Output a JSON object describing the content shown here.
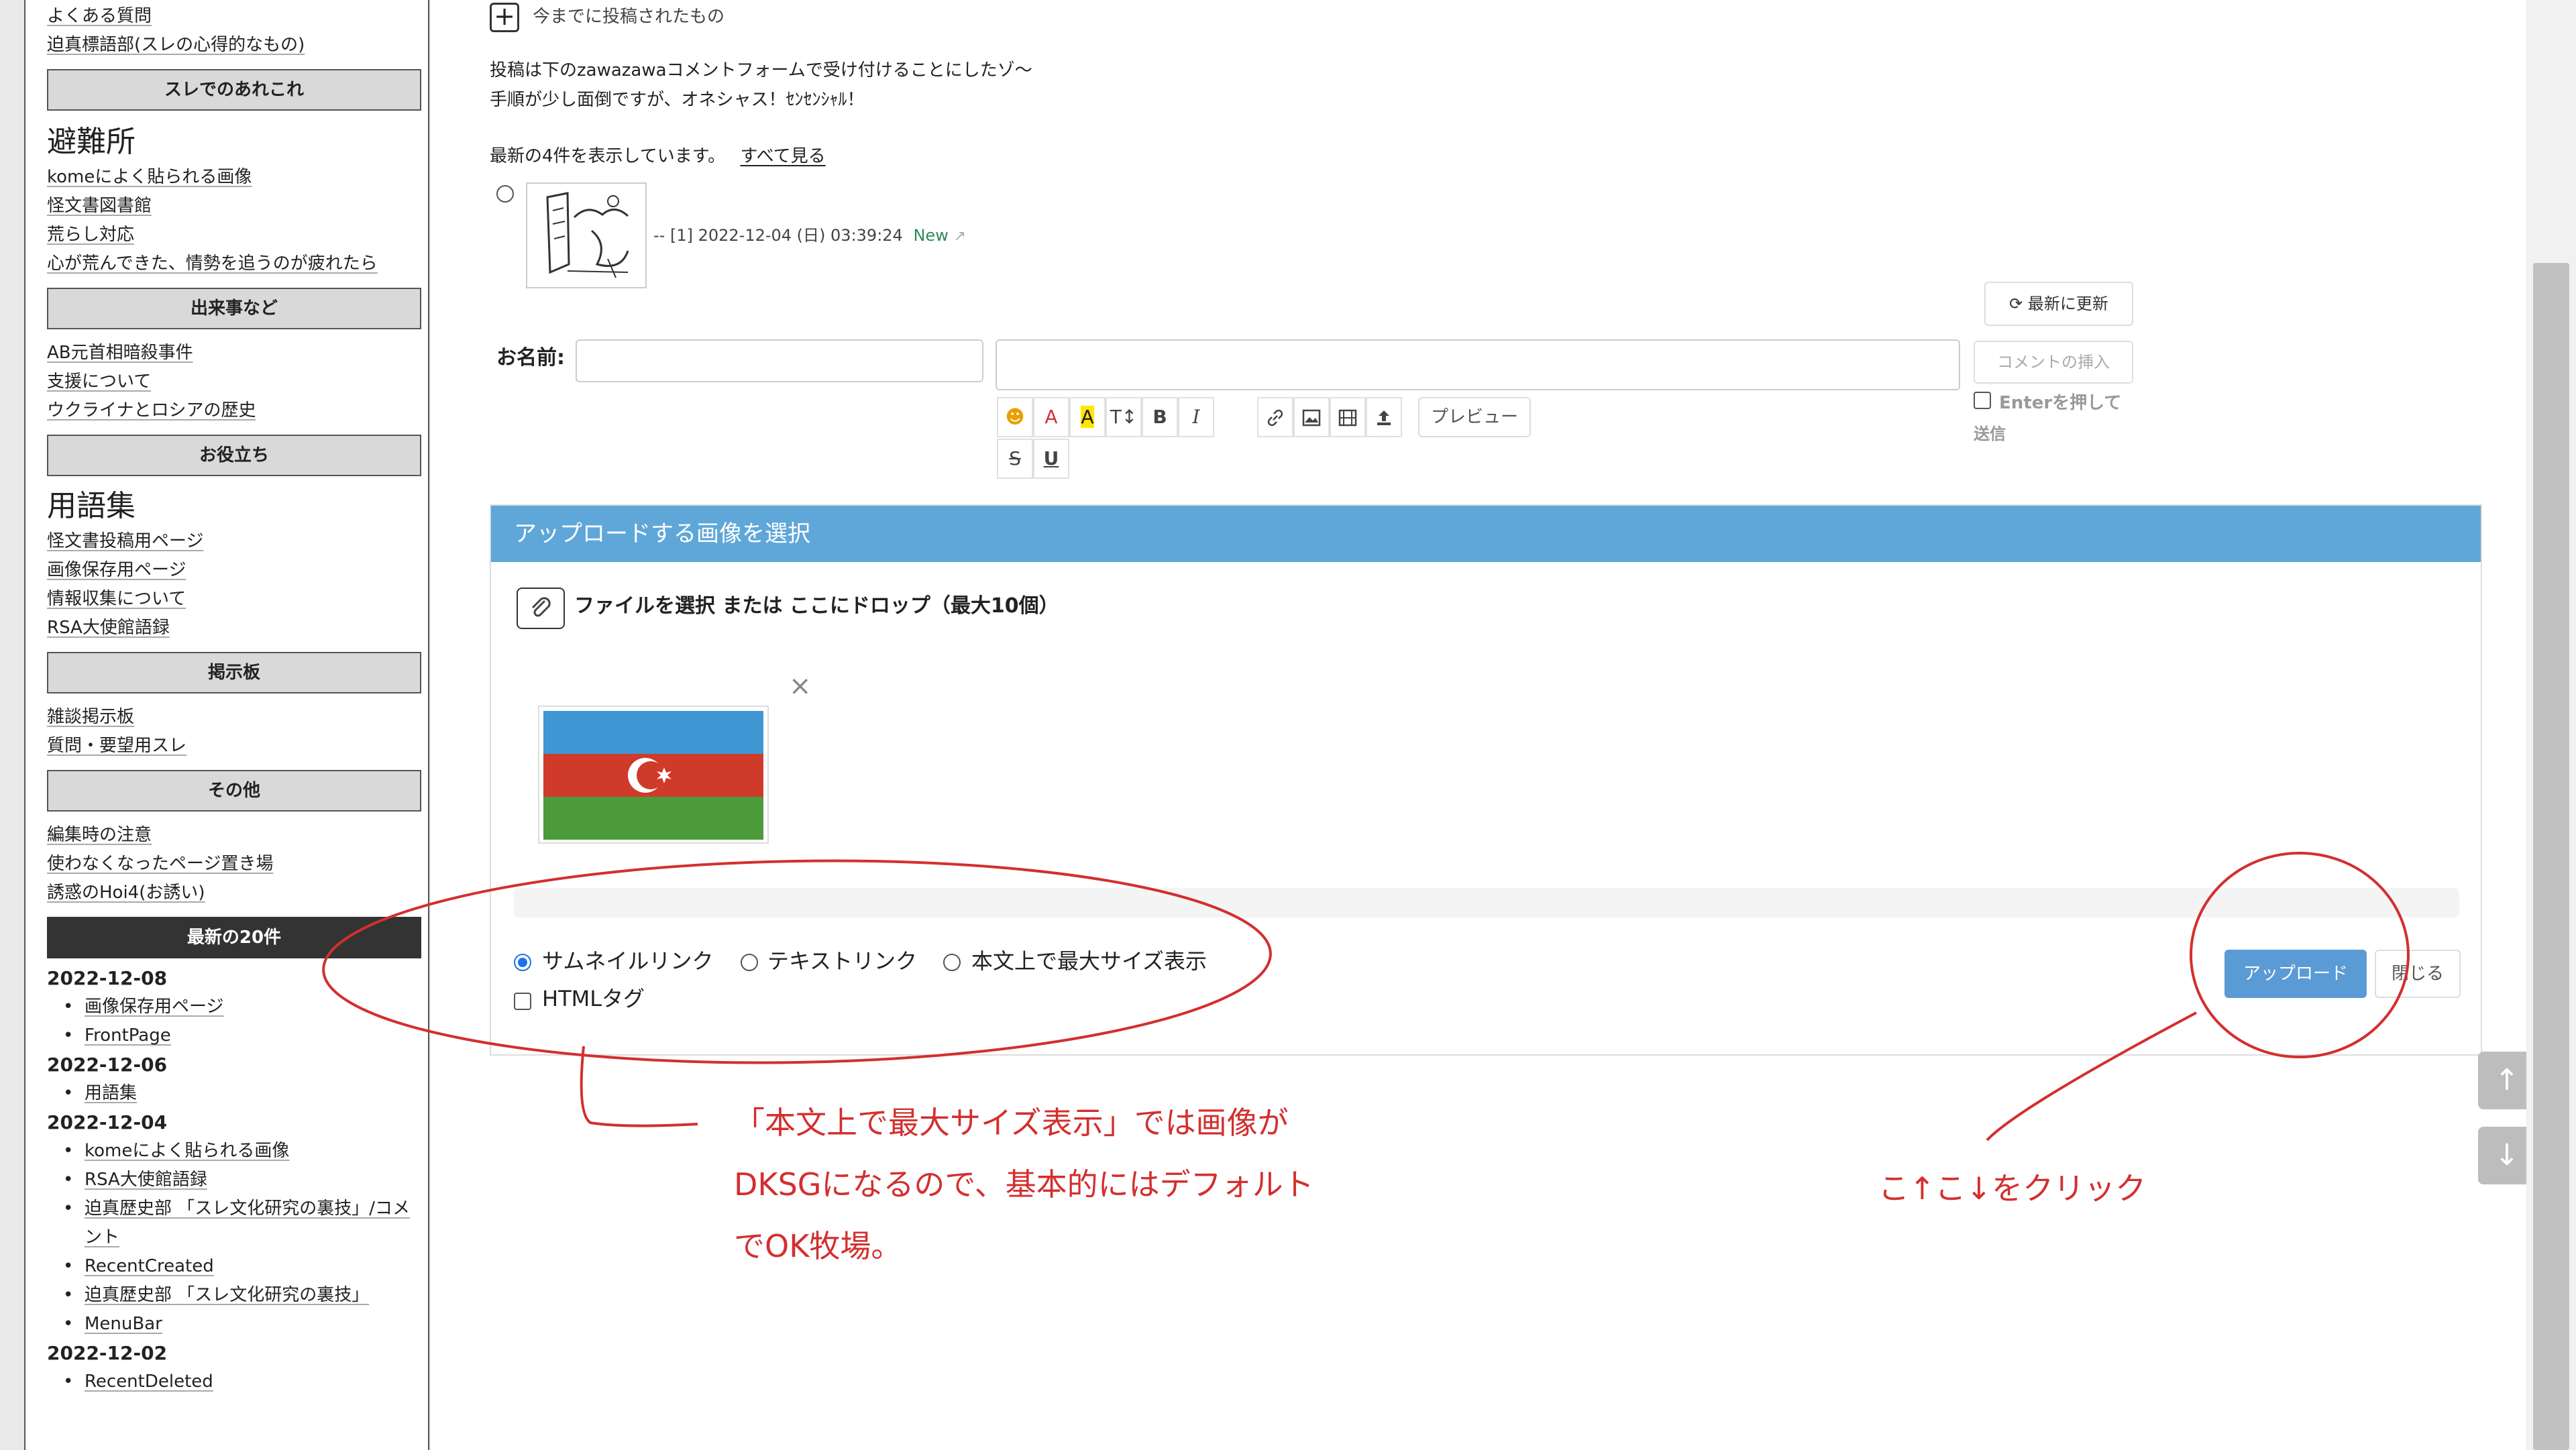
{
  "sidebar": {
    "top_links": [
      "よくある質問",
      "迫真標語部(スレの心得的なもの)"
    ],
    "head_thread": "スレでのあれこれ",
    "refuge_title": "避難所",
    "refuge_links": [
      "komeによく貼られる画像",
      "怪文書図書館",
      "荒らし対応",
      "心が荒んできた、情勢を追うのが疲れたら"
    ],
    "head_events": "出来事など",
    "event_links": [
      "AB元首相暗殺事件",
      "支援について",
      "ウクライナとロシアの歴史"
    ],
    "head_useful": "お役立ち",
    "glossary_title": "用語集",
    "useful_links": [
      "怪文書投稿用ページ",
      "画像保存用ページ",
      "情報収集について",
      "RSA大使館語録"
    ],
    "head_board": "掲示板",
    "board_links": [
      "雑談掲示板",
      "質問・要望用スレ"
    ],
    "head_other": "その他",
    "other_links": [
      "編集時の注意",
      "使わなくなったページ置き場",
      "誘惑のHoi4(お誘い)"
    ],
    "head_recent": "最新の20件",
    "recent": [
      {
        "date": "2022-12-08",
        "items": [
          "画像保存用ページ",
          "FrontPage"
        ]
      },
      {
        "date": "2022-12-06",
        "items": [
          "用語集"
        ]
      },
      {
        "date": "2022-12-04",
        "items": [
          "komeによく貼られる画像",
          "RSA大使館語録",
          "迫真歴史部 「スレ文化研究の裏技」/コメント",
          "RecentCreated",
          "迫真歴史部 「スレ文化研究の裏技」",
          "MenuBar"
        ]
      },
      {
        "date": "2022-12-02",
        "items": [
          "RecentDeleted"
        ]
      }
    ]
  },
  "main": {
    "expand_label": "今までに投稿されたもの",
    "intro_line1": "投稿は下のzawazawaコメントフォームで受け付けることにしたゾ〜",
    "intro_line2": "手順が少し面倒ですが、オネシャス！ｾﾝｾﾝｼｬﾙ！",
    "latest_prefix": "最新の4件を表示しています。",
    "see_all": "すべて見る",
    "comment_meta": "-- [1] 2022-12-04 (日) 03:39:24",
    "comment_new": "New",
    "refresh_label": "最新に更新",
    "name_label": "お名前:",
    "insert_comment": "コメントの挿入",
    "enter_send": "Enterを押して",
    "enter_send2": "送信",
    "preview": "プレビュー",
    "toolbar": [
      "☻",
      "A",
      "A",
      "T↕",
      "B",
      "I"
    ],
    "toolbar2": [
      "S",
      "U"
    ]
  },
  "upload": {
    "header": "アップロードする画像を選択",
    "choose": "ファイルを選択 または ここにドロップ（最大10個）",
    "close_x": "×",
    "options": [
      "サムネイルリンク",
      "テキストリンク",
      "本文上で最大サイズ表示"
    ],
    "html_tag": "HTMLタグ",
    "upload_btn": "アップロード",
    "close_btn": "閉じる"
  },
  "annotations": {
    "line1": "「本文上で最大サイズ表示」では画像が",
    "line2": "DKSGになるので、基本的にはデフォルト",
    "line3": "でOK牧場。",
    "click_note": "こ↑こ↓をクリック"
  },
  "colors": {
    "accent": "#5fa7d8",
    "annotation": "#d32f2f",
    "button": "#5b9bd5"
  }
}
